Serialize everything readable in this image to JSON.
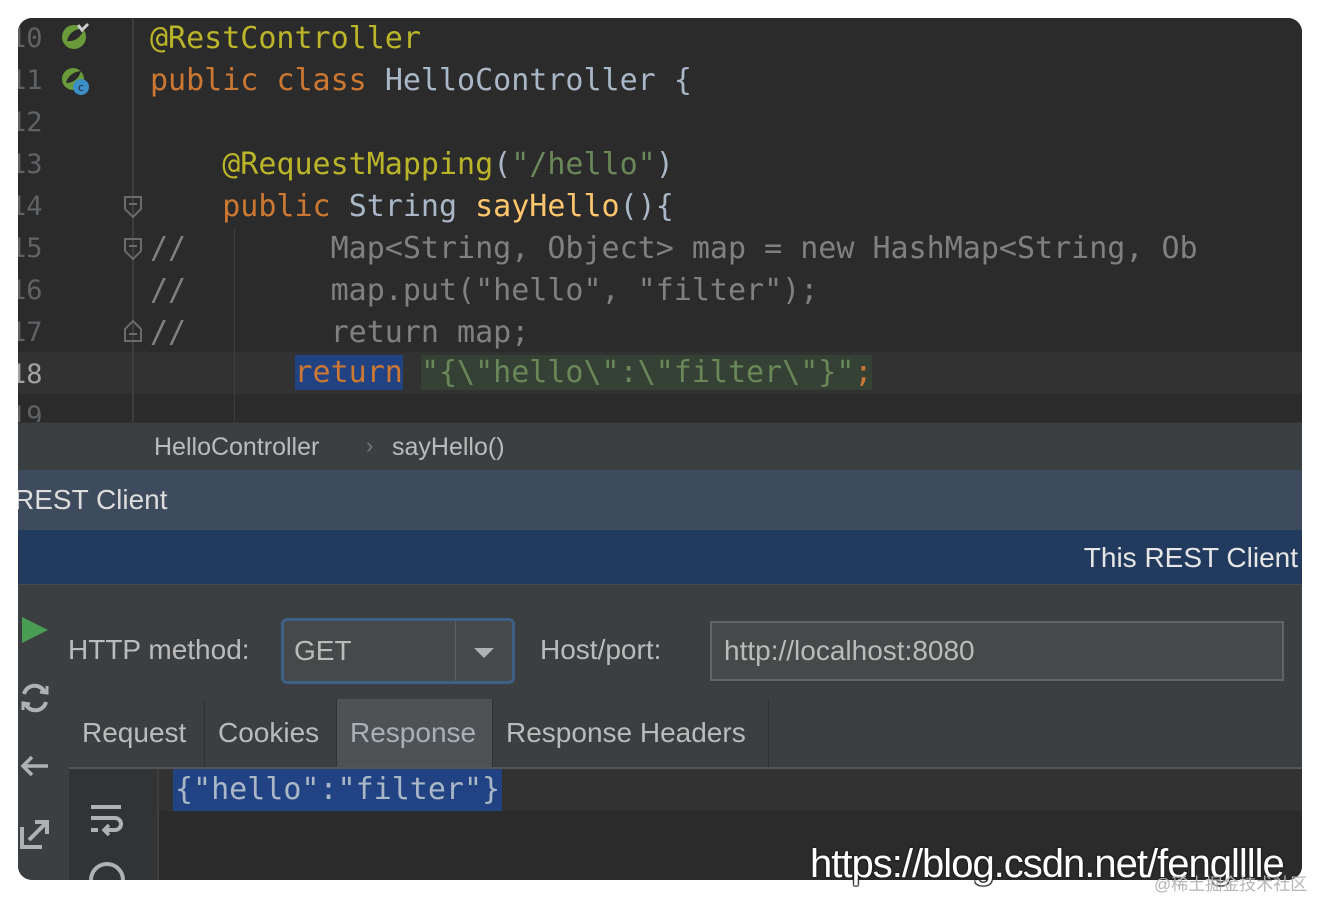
{
  "editor": {
    "line_numbers": [
      "10",
      "11",
      "12",
      "13",
      "14",
      "15",
      "16",
      "17",
      "18",
      "19"
    ],
    "lines": {
      "l10": {
        "annotation": "@RestController"
      },
      "l11": {
        "kw1": "public",
        "kw2": "class",
        "name": "HelloController",
        "brace": "{"
      },
      "l13": {
        "annotation": "@RequestMapping",
        "open": "(",
        "string": "\"/hello\"",
        "close": ")"
      },
      "l14": {
        "kw": "public",
        "type": "String",
        "method": "sayHello",
        "rest": "(){"
      },
      "l15": {
        "comment": "//        Map<String, Object> map = new HashMap<String, Ob"
      },
      "l16": {
        "comment": "//        map.put(\"hello\", \"filter\");"
      },
      "l17": {
        "comment": "//        return map;"
      },
      "l18": {
        "kw": "return",
        "string": "\"{\\\"hello\\\":\\\"filter\\\"}\"",
        "semi": ";"
      }
    }
  },
  "breadcrumb": {
    "class": "HelloController",
    "method": "sayHello()"
  },
  "tool_window": {
    "title": "REST Client",
    "banner": "This REST Client"
  },
  "request": {
    "method_label": "HTTP method:",
    "method_value": "GET",
    "host_label": "Host/port:",
    "host_value": "http://localhost:8080"
  },
  "tabs": [
    "Request",
    "Cookies",
    "Response",
    "Response Headers"
  ],
  "active_tab": "Response",
  "response": {
    "body": "{\"hello\":\"filter\"}"
  },
  "watermark": {
    "main": "https://blog.csdn.net/fenglllle",
    "sub": "@稀土掘金技术社区"
  },
  "colors": {
    "editor_bg": "#2b2b2b",
    "annotation": "#bbb529",
    "keyword": "#cc7832",
    "method": "#ffc66d",
    "string": "#6a8759",
    "comment": "#808080",
    "selection": "#214283",
    "tool_title_bg": "#3d4b5c",
    "banner_bg": "#213a5e"
  },
  "icons": [
    "spring-bean-icon",
    "spring-class-icon",
    "fold-icon",
    "run-icon",
    "refresh-icon",
    "back-arrow-icon",
    "export-icon",
    "soft-wrap-icon",
    "dropdown-arrow-icon"
  ]
}
